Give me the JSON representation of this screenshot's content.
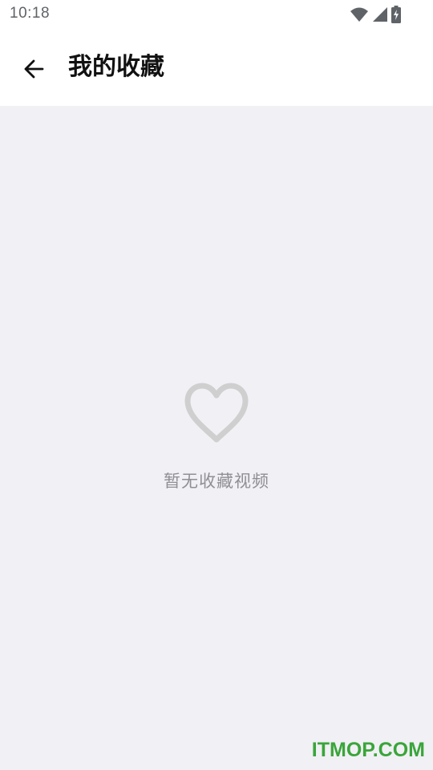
{
  "status_bar": {
    "time": "10:18",
    "icons": [
      "wifi-icon",
      "signal-icon",
      "battery-charging-icon"
    ]
  },
  "app_bar": {
    "back_icon": "arrow-back-icon",
    "title": "我的收藏"
  },
  "empty_state": {
    "icon": "heart-outline-icon",
    "message": "暂无收藏视频"
  },
  "watermark": {
    "text": "ITMOP.COM"
  },
  "colors": {
    "background": "#f1f0f5",
    "bar_background": "#ffffff",
    "title": "#111111",
    "empty_icon": "#cfcfcf",
    "empty_text": "#8f8f94",
    "watermark": "#3aa53a"
  }
}
